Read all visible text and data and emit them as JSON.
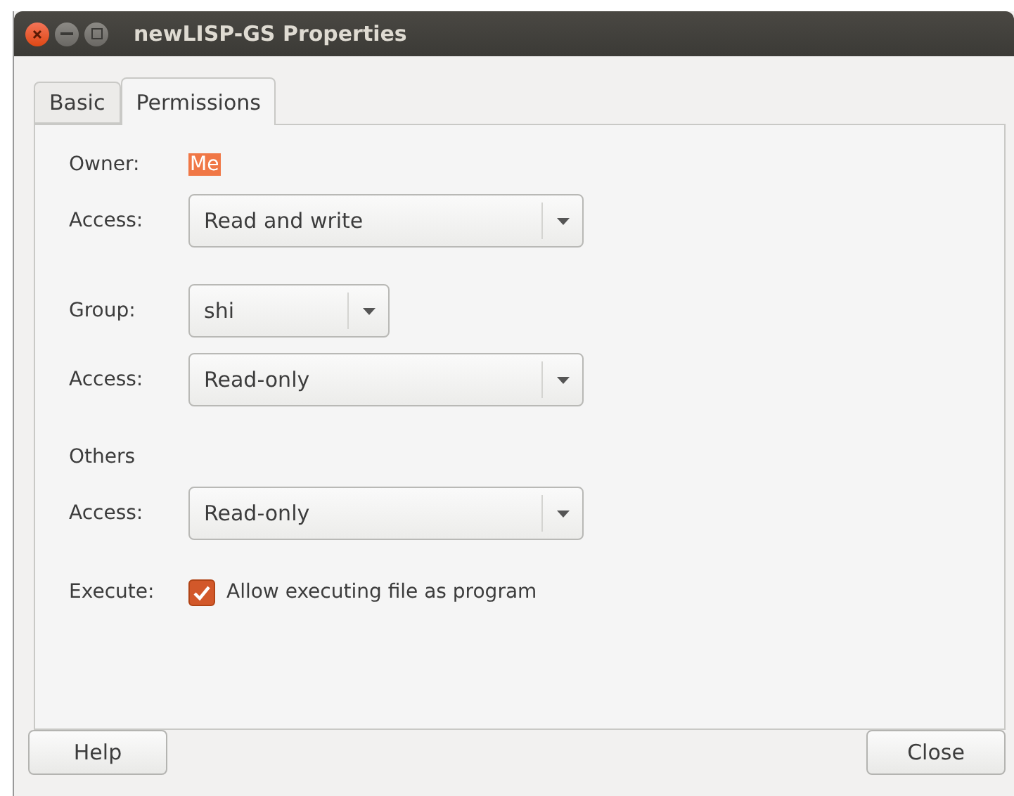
{
  "window": {
    "title": "newLISP-GS Properties"
  },
  "tabs": [
    {
      "label": "Basic",
      "selected": false
    },
    {
      "label": "Permissions",
      "selected": true
    }
  ],
  "sections": [
    {
      "rows": [
        {
          "kind": "value",
          "label": "Owner:",
          "value": "Me",
          "highlighted": true
        },
        {
          "kind": "combo",
          "label": "Access:",
          "value": "Read and write",
          "wide": true
        }
      ]
    },
    {
      "rows": [
        {
          "kind": "combo",
          "label": "Group:",
          "value": "shi",
          "wide": false
        },
        {
          "kind": "combo",
          "label": "Access:",
          "value": "Read-only",
          "wide": true
        }
      ]
    },
    {
      "rows": [
        {
          "kind": "heading",
          "label": "Others"
        },
        {
          "kind": "combo",
          "label": "Access:",
          "value": "Read-only",
          "wide": true
        }
      ]
    },
    {
      "rows": [
        {
          "kind": "checkbox",
          "label": "Execute:",
          "value": "Allow executing file as program",
          "checked": true
        }
      ]
    }
  ],
  "buttons": [
    "Help",
    "Close"
  ]
}
